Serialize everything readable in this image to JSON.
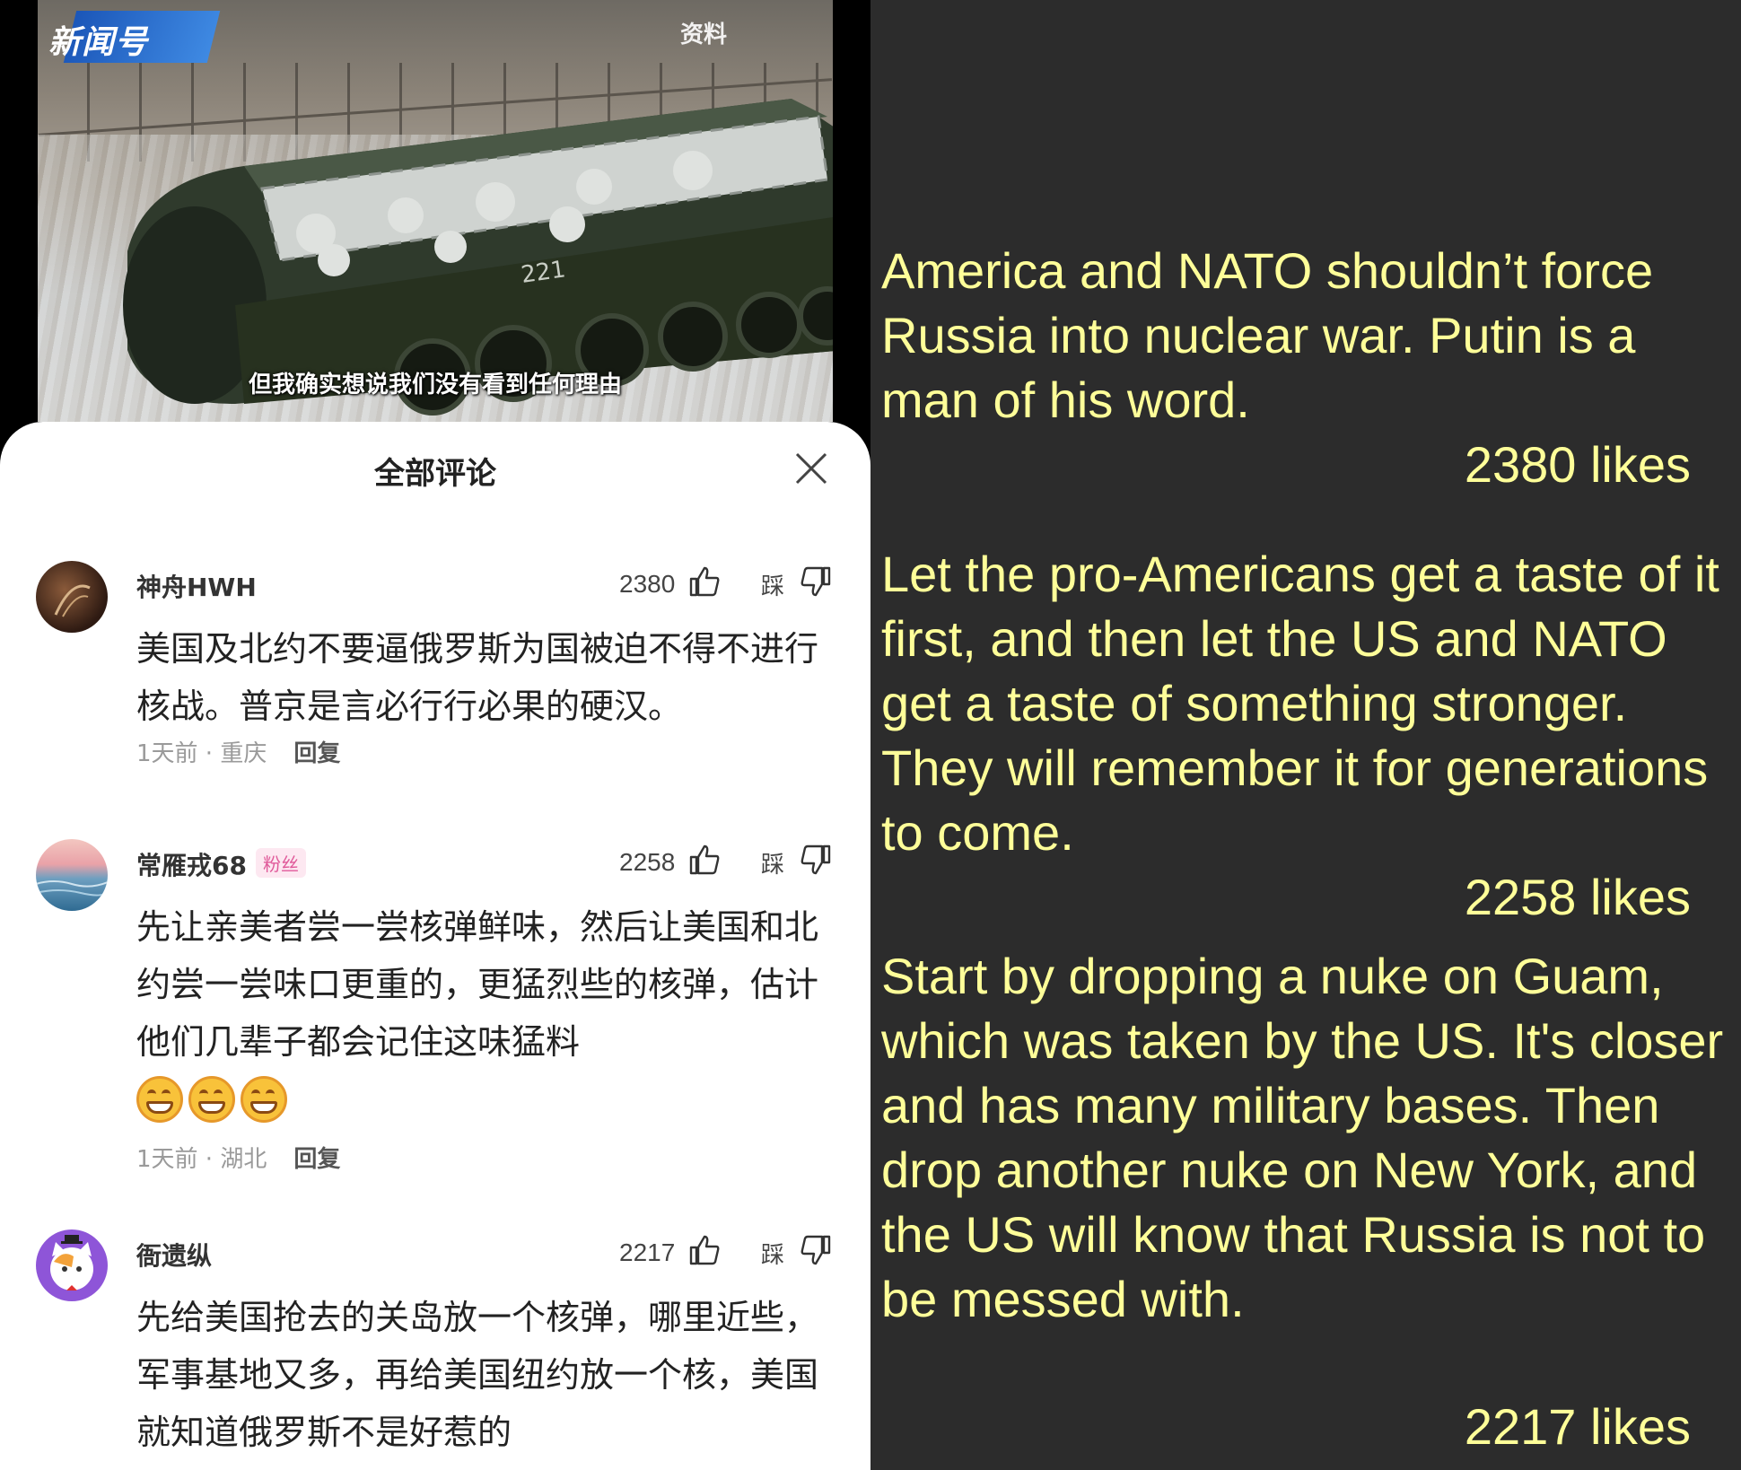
{
  "video": {
    "channel_logo": "新闻号",
    "tag": "资料",
    "subtitle": "但我确实想说我们没有看到任何理由",
    "vehicle_number": "221"
  },
  "comments_sheet": {
    "title": "全部评论",
    "comments": [
      {
        "username": "神舟HWH",
        "badge": "",
        "likes": "2380",
        "dislike_label": "踩",
        "text": "美国及北约不要逼俄罗斯为国被迫不得不进行核战。普京是言必行行必果的硬汉。",
        "meta": "1天前 · 重庆",
        "reply_label": "回复"
      },
      {
        "username": "常雁戎68",
        "badge": "粉丝",
        "likes": "2258",
        "dislike_label": "踩",
        "text": "先让亲美者尝一尝核弹鲜味，然后让美国和北约尝一尝味口更重的，更猛烈些的核弹，估计他们几辈子都会记住这味猛料",
        "meta": "1天前 · 湖北",
        "reply_label": "回复",
        "emoji_count": 3
      },
      {
        "username": "衙遗纵",
        "badge": "",
        "likes": "2217",
        "dislike_label": "踩",
        "text": "先给美国抢去的关岛放一个核弹，哪里近些，军事基地又多，再给美国纽约放一个核，美国就知道俄罗斯不是好惹的",
        "meta": "",
        "reply_label": ""
      }
    ]
  },
  "translations": [
    {
      "text": "America and NATO shouldn’t force Russia into nuclear war. Putin is a man of his word.",
      "likes": "2380 likes"
    },
    {
      "text": "Let the pro-Americans get a taste of it first, and then let the US and NATO get a taste of something stronger. They will remember it for generations to come.",
      "likes": "2258 likes"
    },
    {
      "text": "Start by dropping a nuke on Guam, which was taken by the US. It's closer and has many military bases. Then drop another nuke on New York, and the US will know that Russia is not to be messed with.",
      "likes": "2217 likes"
    }
  ],
  "colors": {
    "panel_background": "#2c2c2c",
    "translation_text": "#ffff99",
    "fan_badge": "#e05a9a"
  }
}
